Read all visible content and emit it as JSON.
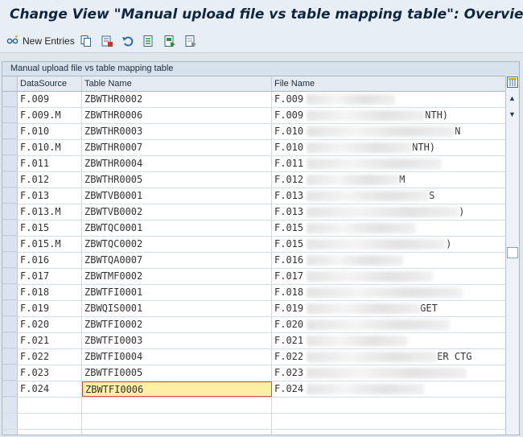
{
  "window": {
    "title": "Change View \"Manual upload file vs table mapping table\": Overview"
  },
  "toolbar": {
    "new_entries_label": "New Entries",
    "icons": [
      "glasses-edit-icon",
      "copy-icon",
      "delete-icon",
      "undo-icon",
      "select-all-icon",
      "select-block-icon",
      "deselect-all-icon"
    ]
  },
  "table": {
    "caption": "Manual upload file vs table mapping table",
    "columns": {
      "datasource": "DataSource",
      "table_name": "Table Name",
      "file_name": "File Name"
    },
    "rows": [
      {
        "ds": "F.009",
        "tn": "ZBWTHR0002",
        "fn": "F.009",
        "fn_tail": ""
      },
      {
        "ds": "F.009.M",
        "tn": "ZBWTHR0006",
        "fn": "F.009",
        "fn_tail": "NTH)"
      },
      {
        "ds": "F.010",
        "tn": "ZBWTHR0003",
        "fn": "F.010",
        "fn_tail": "N"
      },
      {
        "ds": "F.010.M",
        "tn": "ZBWTHR0007",
        "fn": "F.010",
        "fn_tail": "NTH)"
      },
      {
        "ds": "F.011",
        "tn": "ZBWTHR0004",
        "fn": "F.011",
        "fn_tail": ""
      },
      {
        "ds": "F.012",
        "tn": "ZBWTHR0005",
        "fn": "F.012",
        "fn_tail": "M"
      },
      {
        "ds": "F.013",
        "tn": "ZBWTVB0001",
        "fn": "F.013",
        "fn_tail": "S"
      },
      {
        "ds": "F.013.M",
        "tn": "ZBWTVB0002",
        "fn": "F.013",
        "fn_tail": ")"
      },
      {
        "ds": "F.015",
        "tn": "ZBWTQC0001",
        "fn": "F.015",
        "fn_tail": ""
      },
      {
        "ds": "F.015.M",
        "tn": "ZBWTQC0002",
        "fn": "F.015",
        "fn_tail": ")"
      },
      {
        "ds": "F.016",
        "tn": "ZBWTQA0007",
        "fn": "F.016",
        "fn_tail": ""
      },
      {
        "ds": "F.017",
        "tn": "ZBWTMF0002",
        "fn": "F.017",
        "fn_tail": ""
      },
      {
        "ds": "F.018",
        "tn": "ZBWTFI0001",
        "fn": "F.018",
        "fn_tail": ""
      },
      {
        "ds": "F.019",
        "tn": "ZBWQIS0001",
        "fn": "F.019",
        "fn_tail": "GET"
      },
      {
        "ds": "F.020",
        "tn": "ZBWTFI0002",
        "fn": "F.020",
        "fn_tail": ""
      },
      {
        "ds": "F.021",
        "tn": "ZBWTFI0003",
        "fn": "F.021",
        "fn_tail": ""
      },
      {
        "ds": "F.022",
        "tn": "ZBWTFI0004",
        "fn": "F.022",
        "fn_tail": "ER CTG"
      },
      {
        "ds": "F.023",
        "tn": "ZBWTFI0005",
        "fn": "F.023",
        "fn_tail": ""
      },
      {
        "ds": "F.024",
        "tn": "ZBWTFI0006",
        "fn": "F.024",
        "fn_tail": ""
      }
    ],
    "empty_rows": 3
  },
  "colors": {
    "title_text": "#10263f",
    "selected_cell": "#fdf0a5",
    "selected_border": "#d84c4c"
  }
}
